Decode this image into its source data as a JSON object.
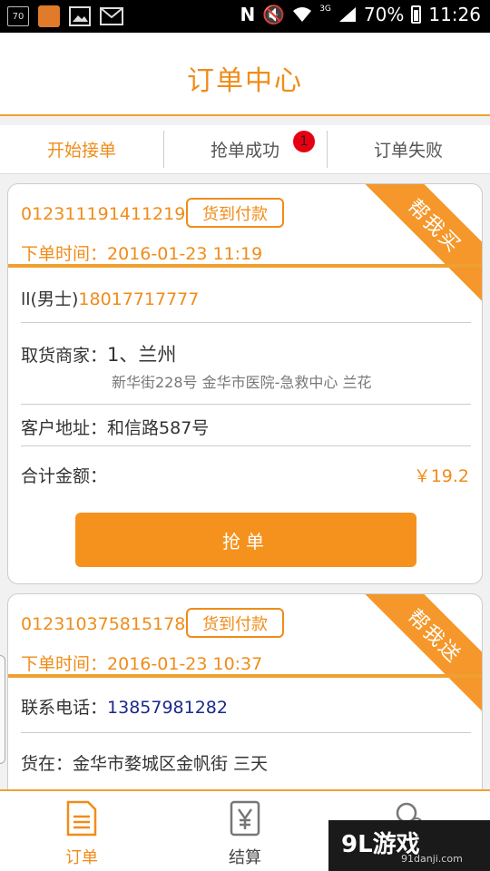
{
  "status_bar": {
    "notif_badge": "70",
    "network": "3G",
    "battery": "70%",
    "time": "11:26"
  },
  "header": {
    "title": "订单中心"
  },
  "tabs": [
    {
      "label": "开始接单",
      "active": true
    },
    {
      "label": "抢单成功",
      "badge": "1"
    },
    {
      "label": "订单失败"
    }
  ],
  "orders": [
    {
      "order_no": "012311191411219",
      "pay_tag": "货到付款",
      "time_label": "下单时间：",
      "time": "2016-01-23 11:19",
      "ribbon": "帮我买",
      "customer_name": "ll(男士)",
      "customer_phone": "18017717777",
      "merchant_label": "取货商家：",
      "merchant": "1、兰州",
      "merchant_address": "新华街228号 金华市医院-急救中心 兰花",
      "address_label": "客户地址：",
      "address": "和信路587号",
      "total_label": "合计金额：",
      "total": "￥19.2",
      "action": "抢单"
    },
    {
      "order_no": "012310375815178",
      "pay_tag": "货到付款",
      "time_label": "下单时间：",
      "time": "2016-01-23 10:37",
      "ribbon": "帮我送",
      "phone_label": "联系电话：",
      "phone": "13857981282",
      "goods_at": "货在：金华市婺城区金帆街 三天"
    }
  ],
  "bottom_nav": [
    {
      "label": "订单",
      "icon": "order-icon",
      "active": true
    },
    {
      "label": "结算",
      "icon": "yen-icon"
    },
    {
      "label": "",
      "icon": "user-add-icon"
    }
  ],
  "watermark": {
    "logo": "9L游戏",
    "site": "91danji.com"
  },
  "colors": {
    "accent": "#f08c19",
    "badge": "#e60012",
    "link": "#1a2a8c"
  }
}
